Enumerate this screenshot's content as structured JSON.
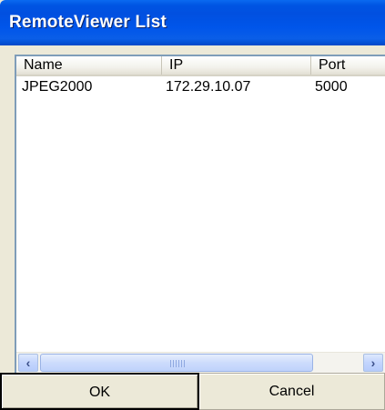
{
  "window": {
    "title": "RemoteViewer List"
  },
  "list": {
    "columns": [
      "Name",
      "IP",
      "Port"
    ],
    "rows": [
      {
        "name": "JPEG2000",
        "ip": "172.29.10.07",
        "port": "5000"
      }
    ]
  },
  "scrollbar": {
    "left_icon": "chevron-left-icon",
    "right_icon": "chevron-right-icon"
  },
  "buttons": {
    "ok_label": "OK",
    "cancel_label": "Cancel"
  },
  "colors": {
    "titlebar": "#0054e3",
    "title_text": "#ffffff",
    "dialog_bg": "#ece9d8",
    "list_border": "#7f9db9"
  }
}
